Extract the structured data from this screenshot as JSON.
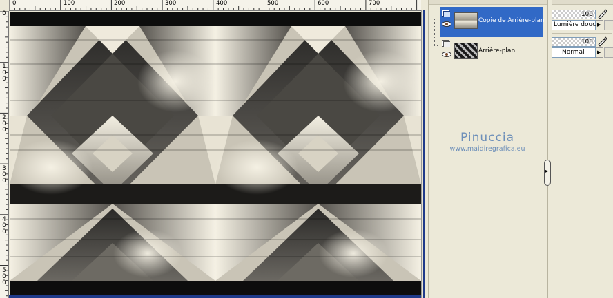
{
  "ruler": {
    "h_labels": [
      "0",
      "100",
      "200",
      "300",
      "400",
      "500",
      "600",
      "700"
    ],
    "v_labels": [
      [
        "0"
      ],
      [
        "1",
        "0",
        "0"
      ],
      [
        "2",
        "0",
        "0"
      ],
      [
        "3",
        "0",
        "0"
      ],
      [
        "4",
        "0",
        "0"
      ],
      [
        "5",
        "0",
        "0"
      ]
    ]
  },
  "canvas": {
    "content": "abstract monochrome geometric diamond pattern"
  },
  "layers": [
    {
      "name": "Copie de Arrière-plan",
      "selected": true,
      "opacity": "100",
      "blend_mode": "Lumière douce"
    },
    {
      "name": "Arrière-plan",
      "selected": false,
      "opacity": "100",
      "blend_mode": "Normal"
    }
  ],
  "watermark": {
    "title": "Pinuccia",
    "url": "www.maidiregrafica.eu"
  },
  "colors": {
    "selection": "#3169c6",
    "panel": "#ece9d8",
    "frame": "#1f3a8a",
    "watermark": "#6d8fb9"
  }
}
